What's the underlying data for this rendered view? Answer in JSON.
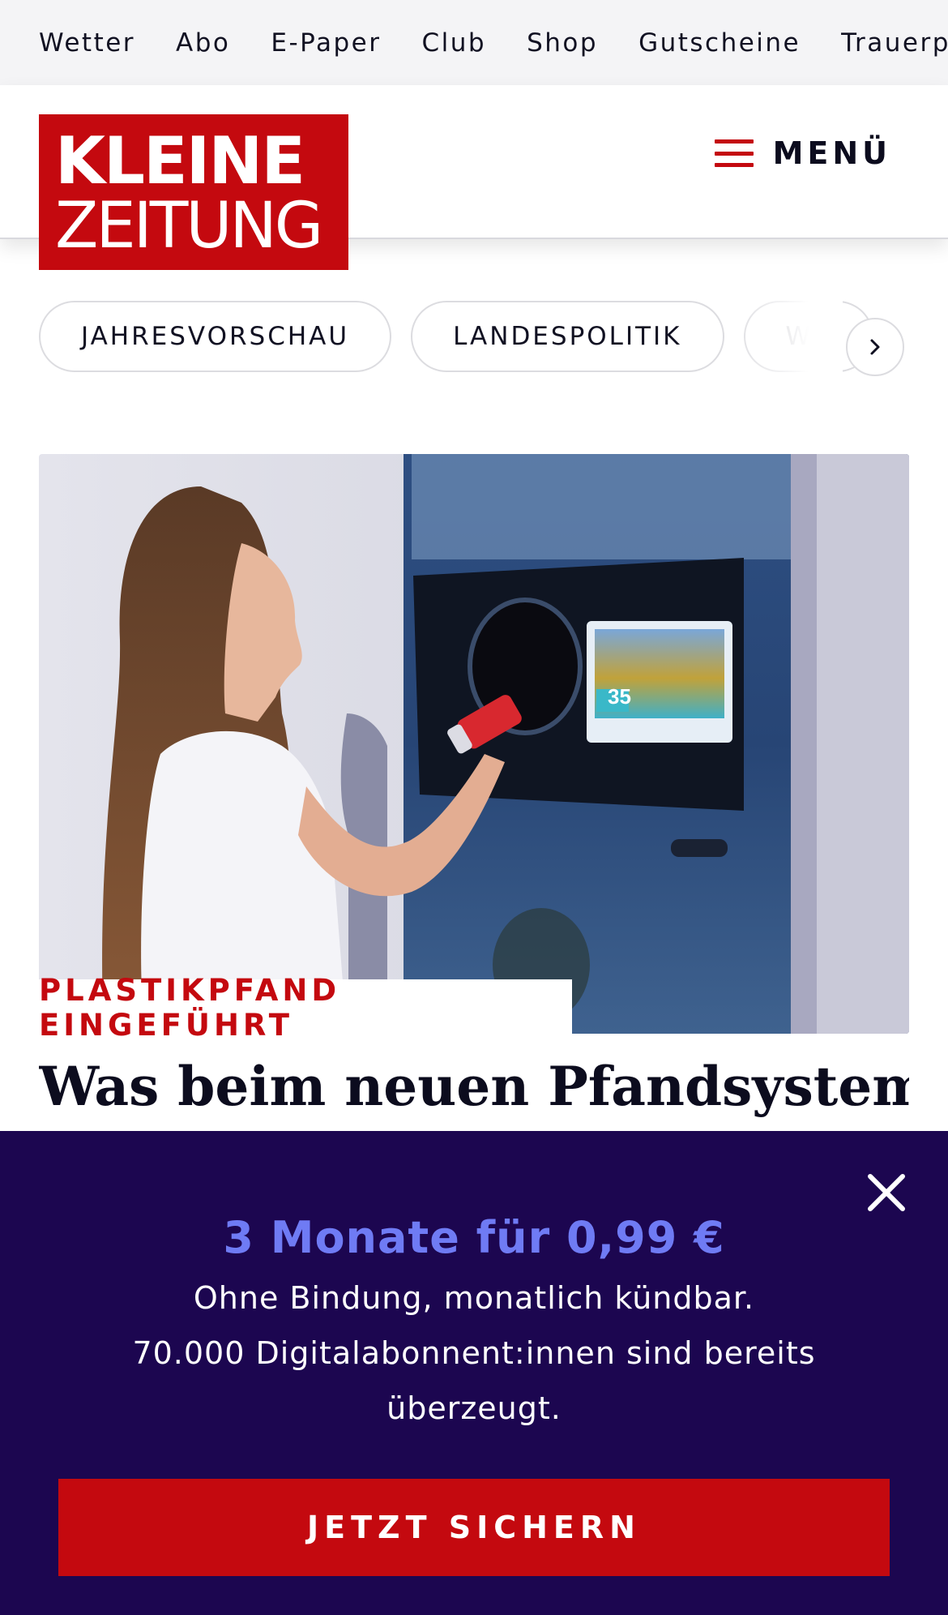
{
  "topnav": {
    "items": [
      "Wetter",
      "Abo",
      "E-Paper",
      "Club",
      "Shop",
      "Gutscheine",
      "Trauerp"
    ]
  },
  "header": {
    "logo_line1": "KLEINE",
    "logo_line2": "ZEITUNG",
    "menu_label": "MENÜ"
  },
  "topics": {
    "pills": [
      "JAHRESVORSCHAU",
      "LANDESPOLITIK",
      "WE"
    ]
  },
  "article": {
    "kicker": "PLASTIKPFAND EINGEFÜHRT",
    "headline": "Was beim neuen Pfandsystem",
    "machine_display_number": "35"
  },
  "promo": {
    "title": "3 Monate für 0,99 €",
    "line1": "Ohne Bindung, monatlich kündbar.",
    "line2": "70.000 Digitalabonnent:innen sind bereits überzeugt.",
    "cta": "JETZT SICHERN"
  },
  "colors": {
    "brand_red": "#c4090f",
    "promo_bg": "#1c0650",
    "promo_accent": "#6f7bf4"
  }
}
